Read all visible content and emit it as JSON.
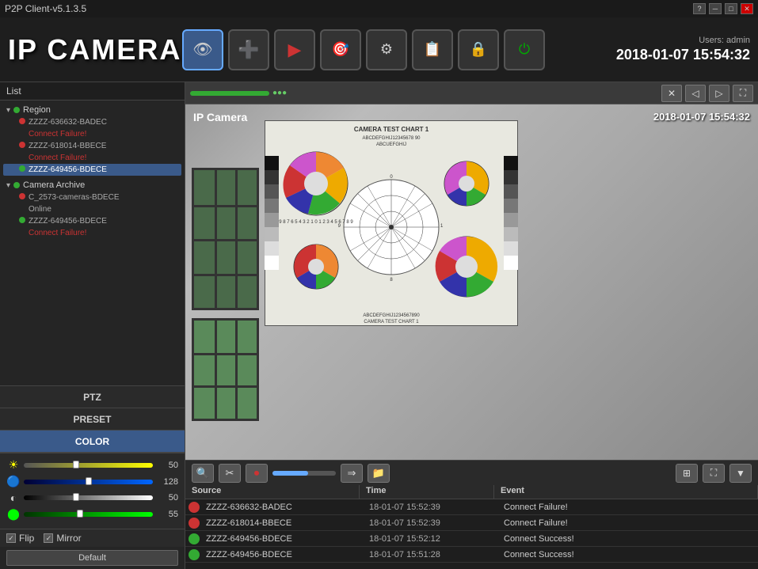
{
  "titlebar": {
    "title": "P2P Client-v5.1.3.5",
    "controls": {
      "help": "?",
      "minimize": "─",
      "maximize": "□",
      "close": "✕"
    }
  },
  "header": {
    "logo": "IP CAMERA",
    "users_label": "Users: admin",
    "datetime": "2018-01-07  15:54:32",
    "toolbar": {
      "items": [
        {
          "name": "camera",
          "icon": "📷",
          "active": true
        },
        {
          "name": "add",
          "icon": "➕",
          "active": false
        },
        {
          "name": "record",
          "icon": "▶",
          "active": false
        },
        {
          "name": "ptz",
          "icon": "🎯",
          "active": false
        },
        {
          "name": "settings",
          "icon": "⚙",
          "active": false
        },
        {
          "name": "files",
          "icon": "📋",
          "active": false
        },
        {
          "name": "lock",
          "icon": "🔒",
          "active": false
        },
        {
          "name": "power",
          "icon": "⏻",
          "active": false
        }
      ]
    }
  },
  "sidebar": {
    "list_label": "List",
    "devices": [
      {
        "id": "group1",
        "status": "green",
        "name": "Region",
        "children": [
          {
            "name": "ZZZZ-636632-BADEC",
            "status": "red",
            "selected": false
          },
          {
            "name": "Connect Failure!",
            "indent": true
          },
          {
            "name": "ZZZZ-618014-BBECE",
            "status": "red",
            "selected": false
          },
          {
            "name": "Connect Failure!",
            "indent": true
          },
          {
            "name": "ZZZZ-649456-BDECE",
            "status": "green",
            "selected": true
          }
        ]
      },
      {
        "id": "group2",
        "status": "green",
        "name": "Camera Archive",
        "children": [
          {
            "name": "C_2573-cameras-BDECE",
            "status": "red",
            "selected": false
          },
          {
            "name": "Online",
            "indent": true
          },
          {
            "name": "ZZZZ-649456-BDECE",
            "status": "green",
            "selected": false
          },
          {
            "name": "Connect Failure!",
            "indent": true
          }
        ]
      }
    ],
    "tabs": [
      {
        "id": "ptz",
        "label": "PTZ"
      },
      {
        "id": "preset",
        "label": "PRESET"
      },
      {
        "id": "color",
        "label": "COLOR",
        "active": true
      }
    ],
    "color_controls": [
      {
        "icon": "☀",
        "color": "#f90",
        "value": 50,
        "percent": 40,
        "bg": "linear-gradient(to right, #888, #fa0)"
      },
      {
        "icon": "🔵",
        "color": "#06f",
        "value": 128,
        "percent": 50,
        "bg": "linear-gradient(to right, #004, #06f)"
      },
      {
        "icon": "◐",
        "color": "#fff",
        "value": 50,
        "percent": 40,
        "bg": "linear-gradient(to right, #000, #fff)"
      },
      {
        "icon": "🟢",
        "color": "#0f0",
        "value": 55,
        "percent": 43,
        "bg": "linear-gradient(to right, #030, #0f0)"
      }
    ],
    "flip_checked": true,
    "mirror_checked": true,
    "flip_label": "Flip",
    "mirror_label": "Mirror",
    "default_label": "Default"
  },
  "video": {
    "camera_label": "IP Camera",
    "timestamp": "2018-01-07  15:54:32",
    "toolbar_timestamp": "2018-01-07  15:54:32"
  },
  "events": {
    "columns": [
      "Source",
      "Time",
      "Event"
    ],
    "rows": [
      {
        "indicator": "red",
        "source": "ZZZZ-636632-BADEC",
        "time": "18-01-07 15:52:39",
        "event": "Connect Failure!"
      },
      {
        "indicator": "red",
        "source": "ZZZZ-618014-BBECE",
        "time": "18-01-07 15:52:39",
        "event": "Connect Failure!"
      },
      {
        "indicator": "green",
        "source": "ZZZZ-649456-BDECE",
        "time": "18-01-07 15:52:12",
        "event": "Connect Success!"
      },
      {
        "indicator": "green",
        "source": "ZZZZ-649456-BDECE",
        "time": "18-01-07 15:51:28",
        "event": "Connect Success!"
      }
    ]
  }
}
